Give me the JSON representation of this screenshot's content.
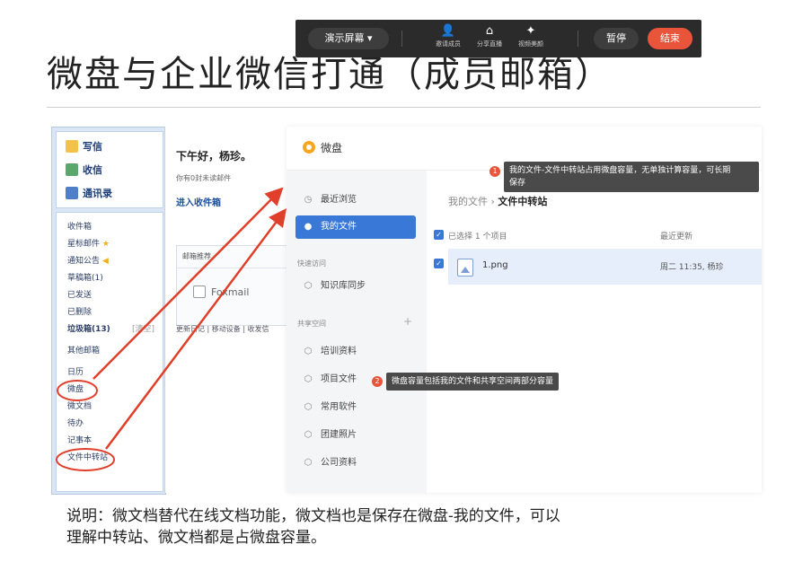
{
  "slide": {
    "title": "微盘与企业微信打通（成员邮箱）",
    "caption_line1": "说明：微文档替代在线文档功能，微文档也是保存在微盘-我的文件，可以",
    "caption_line2": "理解中转站、微文档都是占微盘容量。"
  },
  "share_toolbar": {
    "screen_label": "演示屏幕 ▾",
    "tools": [
      {
        "label": "邀请成员",
        "icon": "invite-member-icon"
      },
      {
        "label": "分享直播",
        "icon": "share-live-icon"
      },
      {
        "label": "视频美颜",
        "icon": "beauty-icon"
      }
    ],
    "pause_label": "暂停",
    "end_label": "结束",
    "end_color": "#e8553a"
  },
  "mail": {
    "compose": "写信",
    "receive": "收信",
    "contacts": "通讯录",
    "folders": [
      "收件箱",
      "星标邮件",
      "通知公告",
      "草稿箱(1)",
      "已发送",
      "已删除",
      "垃圾箱(13)",
      "其他邮箱",
      "日历",
      "微盘",
      "微文档",
      "待办",
      "记事本",
      "文件中转站"
    ],
    "clear_label": "[清空]",
    "greeting": "下午好，杨珍。",
    "unread": "你有0封未读邮件",
    "inbox_link": "进入收件箱",
    "recommend": "邮箱推荐",
    "foxmail": "Foxmail",
    "footer_links": "更新日记 | 移动设备 | 收发信"
  },
  "weipan": {
    "brand": "微盘",
    "brand_color": "#f5a623",
    "nav": {
      "recent": "最近浏览",
      "my_files": "我的文件"
    },
    "quick_access_title": "快速访问",
    "quick_access": [
      "知识库同步"
    ],
    "shared_title": "共享空间",
    "shared": [
      "培训资料",
      "项目文件",
      "常用软件",
      "团建照片",
      "公司资料"
    ],
    "breadcrumb_root": "我的文件",
    "breadcrumb_current": "文件中转站",
    "selected": "已选择 1 个项目",
    "col_updated": "最近更新",
    "file_name": "1.png",
    "file_updated": "周二 11:35, 杨珍",
    "accent": "#3a78d8"
  },
  "tips": {
    "tip1_badge": "1",
    "tip1_line1": "我的文件-文件中转站占用微盘容量，无单独计算容量，可长期",
    "tip1_line2": "保存",
    "tip2_badge": "2",
    "tip2": "微盘容量包括我的文件和共享空间两部分容量"
  }
}
